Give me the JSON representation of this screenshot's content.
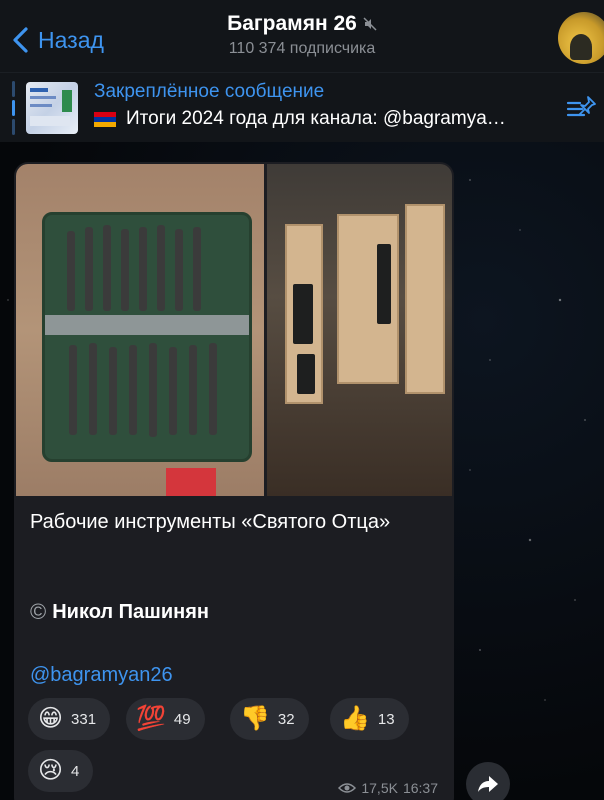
{
  "header": {
    "back_label": "Назад",
    "title": "Баграмян 26",
    "subtitle": "110 374 подписчика"
  },
  "pinned": {
    "title": "Закреплённое сообщение",
    "text": "Итоги 2024 года для канала: @bagramya…"
  },
  "message": {
    "caption": "Рабочие инструменты «Святого Отца»",
    "copyright_symbol": "©",
    "author": "Никол Пашинян",
    "link": "@bagramyan26",
    "reactions": [
      {
        "emoji": "😁",
        "count": "331"
      },
      {
        "emoji": "💯",
        "count": "49"
      },
      {
        "emoji": "👎",
        "count": "32"
      },
      {
        "emoji": "👍",
        "count": "13"
      },
      {
        "emoji": "😢",
        "count": "4"
      }
    ],
    "views": "17,5K",
    "time": "16:37"
  },
  "colors": {
    "accent": "#3e94ef",
    "bubble": "#1c1d22",
    "header": "#121519",
    "reaction_bg": "#2b2d33"
  },
  "icons": [
    "chevron-left-icon",
    "mute-icon",
    "pinned-list-icon",
    "eye-icon",
    "share-icon"
  ]
}
